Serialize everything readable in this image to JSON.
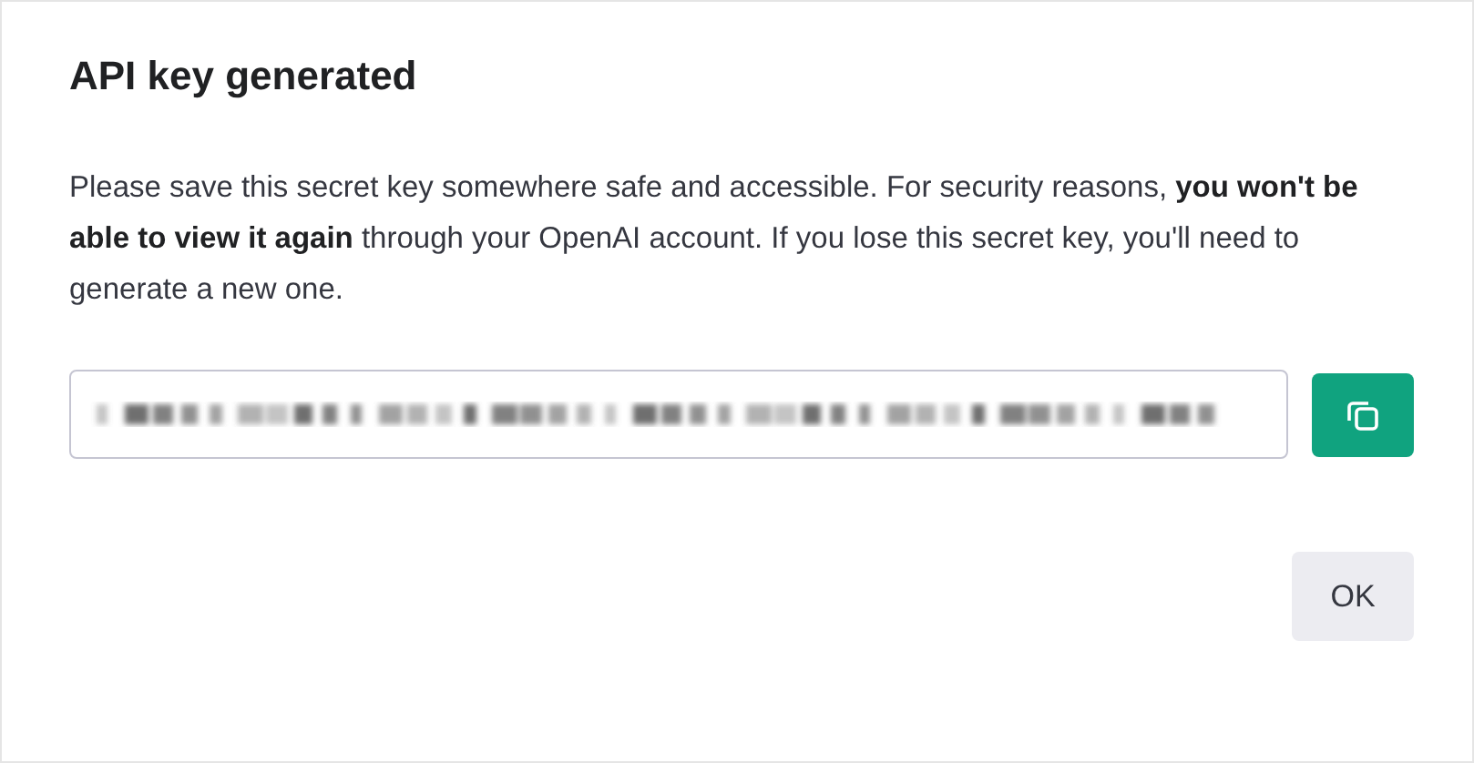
{
  "dialog": {
    "title": "API key generated",
    "message": "Please save this secret key somewhere safe and accessible. For security reasons, **you won't be able to view it again** through your OpenAI account. If you lose this secret key, you'll need to generate a new one.",
    "buttons": [
      "OK"
    ]
  }
}
